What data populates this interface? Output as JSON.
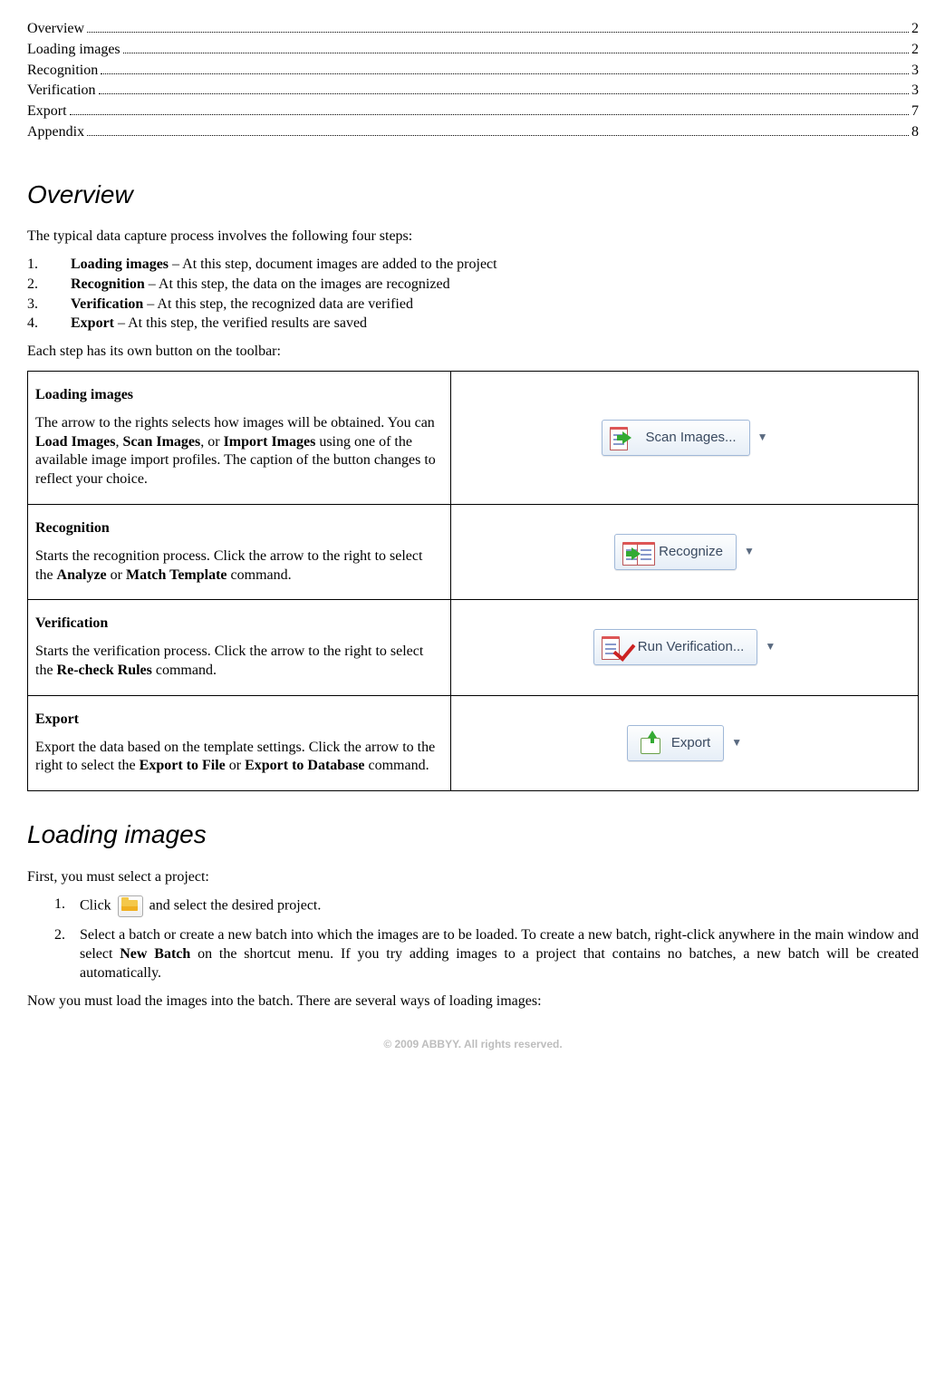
{
  "toc": [
    {
      "label": "Overview",
      "page": "2"
    },
    {
      "label": "Loading images",
      "page": "2"
    },
    {
      "label": "Recognition",
      "page": "3"
    },
    {
      "label": "Verification",
      "page": "3"
    },
    {
      "label": "Export",
      "page": "7"
    },
    {
      "label": "Appendix",
      "page": "8"
    }
  ],
  "overview": {
    "heading": "Overview",
    "intro": "The typical data capture process involves the following four steps:",
    "steps": [
      {
        "n": "1.",
        "strong": "Loading images",
        "rest": " – At this step, document images are added to the project"
      },
      {
        "n": "2.",
        "strong": "Recognition",
        "rest": " – At this step, the data on the images are recognized"
      },
      {
        "n": "3.",
        "strong": "Verification",
        "rest": " – At this step, the recognized data are verified"
      },
      {
        "n": "4.",
        "strong": "Export",
        "rest": " – At this step, the verified results are saved"
      }
    ],
    "toolbar_intro": "Each step has its own button on the toolbar:"
  },
  "buttons": {
    "loading": {
      "title": "Loading images",
      "t1": "The arrow to the rights selects how images will be obtained. You can ",
      "b1": "Load Images",
      "s1": ", ",
      "b2": "Scan Images",
      "s2": ", or ",
      "b3": "Import Images",
      "t2": " using one of the available image import profiles. The caption of the button changes to reflect your choice.",
      "btn_label": "Scan Images..."
    },
    "recognition": {
      "title": "Recognition",
      "t1": "Starts the recognition process. Click the arrow to the right to select the ",
      "b1": "Analyze",
      "s1": " or ",
      "b2": "Match Template",
      "t2": " command.",
      "btn_label": "Recognize"
    },
    "verification": {
      "title": "Verification",
      "t1": "Starts the verification process. Click the arrow to the right to select the ",
      "b1": "Re-check Rules",
      "t2": " command.",
      "btn_label": "Run Verification..."
    },
    "export": {
      "title": "Export",
      "t1": "Export the data based on the template settings. Click the arrow to the right to select the ",
      "b1": "Export to File",
      "s1": " or ",
      "b2": "Export to Database",
      "t2": " command.",
      "btn_label": "Export"
    }
  },
  "loading_section": {
    "heading": "Loading images",
    "intro": "First, you must select a project:",
    "step1_a": "Click ",
    "step1_b": " and select the desired project.",
    "step2_a": "Select a batch or create a new batch into which the images are to be loaded. To create a new batch, right-click anywhere in the main window and select ",
    "step2_bold": "New Batch",
    "step2_b": " on the shortcut menu. If you try adding images to a project that contains no batches, a new batch will be created automatically.",
    "outro": "Now you must load the images into the batch. There are several ways of loading images:",
    "n1": "1.",
    "n2": "2."
  },
  "footer": "© 2009 ABBYY. All rights reserved."
}
